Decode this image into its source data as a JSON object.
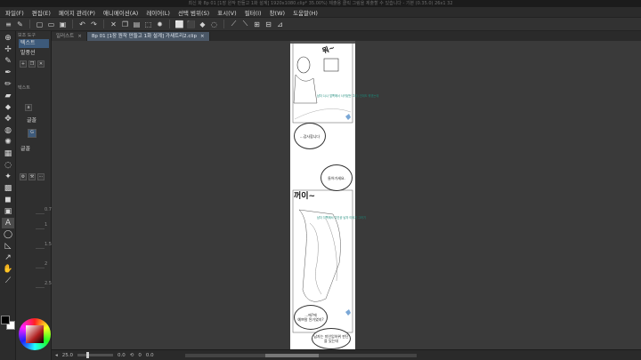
{
  "window": {
    "title": "최신 화 8p 01 [1장 원작 만들고 1화 설계] 1920x1080.clip* 35.00%) 제출용 클릭 그림을 제출할 수 있습니다 - 기본 (0.35.0) 26x1 32"
  },
  "menu": [
    "파일(F)",
    "편집(E)",
    "페이지 관리(P)",
    "애니메이션(A)",
    "레이어(L)",
    "선택 범위(S)",
    "표시(V)",
    "필터(I)",
    "창(W)",
    "도움말(H)"
  ],
  "tabs": [
    {
      "label": "일러스트",
      "close": "×",
      "active": false
    },
    {
      "label": "8p 01 [1장 원작 만들고 1화 설계] 가새트리2.clip",
      "close": "×",
      "active": true
    }
  ],
  "subtool": {
    "header": "보조 도구",
    "items": [
      "텍스트",
      "말풍선"
    ],
    "group_label": "텍스트",
    "slot_a": "글꼴",
    "slot_b": "글꼴",
    "ruler": [
      "0.7",
      "1",
      "1.5",
      "2",
      "2.5"
    ]
  },
  "statusbar": {
    "zoom": "25.0",
    "angle": "0.0",
    "coords": "0",
    "page": "0.0"
  },
  "comic": {
    "bubbles": [
      "...감사합니다",
      "들어가세요.",
      "...에?에\n예쁘말 된거였지?",
      "남자는 미인입하위 판단을 있는데"
    ],
    "sfx": [
      "꺼이~",
      "뭐~"
    ],
    "notes": [
      "남자 1(나 앞쪽에서 사귀었던\n그녀) 인데도 뭐였는데",
      "남자 뒤쪽에서 주인공\n남자 이야기 그러기"
    ]
  },
  "colors": {
    "accent": "#4a5766",
    "canvas_bg": "#3a3a3a",
    "page": "#ffffff",
    "note": "#1b8a7a"
  }
}
